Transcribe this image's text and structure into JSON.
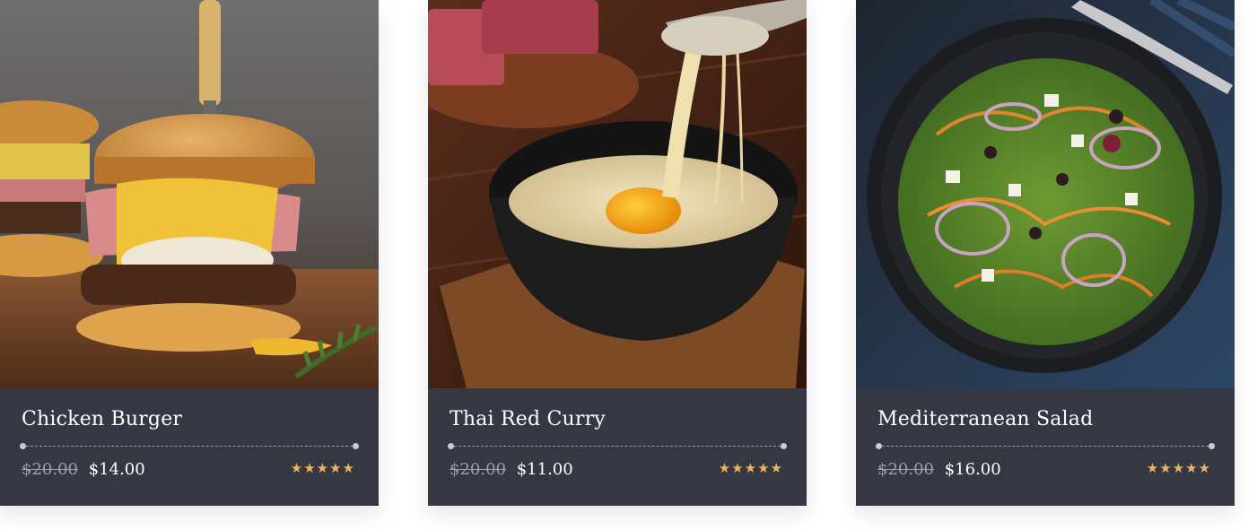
{
  "menu_items": [
    {
      "title": "Chicken Burger",
      "old_price": "$20.00",
      "price": "$14.00",
      "rating": 5,
      "rating_stars": "★★★★★",
      "image": "chicken-burger-photo"
    },
    {
      "title": "Thai Red Curry",
      "old_price": "$20.00",
      "price": "$11.00",
      "rating": 5,
      "rating_stars": "★★★★★",
      "image": "thai-red-curry-photo"
    },
    {
      "title": "Mediterranean Salad",
      "old_price": "$20.00",
      "price": "$16.00",
      "rating": 5,
      "rating_stars": "★★★★★",
      "image": "mediterranean-salad-photo"
    }
  ],
  "colors": {
    "card_background": "#353842",
    "star": "#e7b566",
    "old_price": "#9c9fa6",
    "title": "#ffffff"
  }
}
